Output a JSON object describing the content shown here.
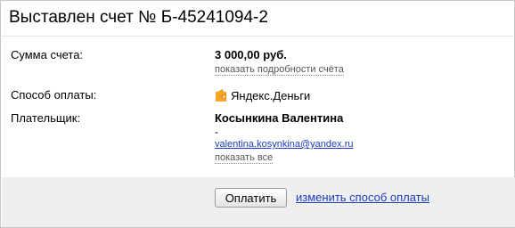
{
  "invoice": {
    "title": "Выставлен счет № Б-45241094-2"
  },
  "amount": {
    "label": "Сумма счета:",
    "value": "3 000,00 руб.",
    "details_link": "показать подробности счёта"
  },
  "payment_method": {
    "label": "Способ оплаты:",
    "value": "Яндекс.Деньги",
    "icon": "yandex-money-wallet-icon",
    "icon_color": "#f5a623"
  },
  "payer": {
    "label": "Плательщик:",
    "name": "Косынкина Валентина",
    "dash": "-",
    "email": "valentina.kosynkina@yandex.ru",
    "show_all_link": "показать все"
  },
  "actions": {
    "pay_button": "Оплатить",
    "change_method_link": "изменить способ оплаты"
  },
  "colors": {
    "link": "#1a3dc1",
    "footer_bg": "#efefef",
    "border": "#c8c8c8"
  }
}
